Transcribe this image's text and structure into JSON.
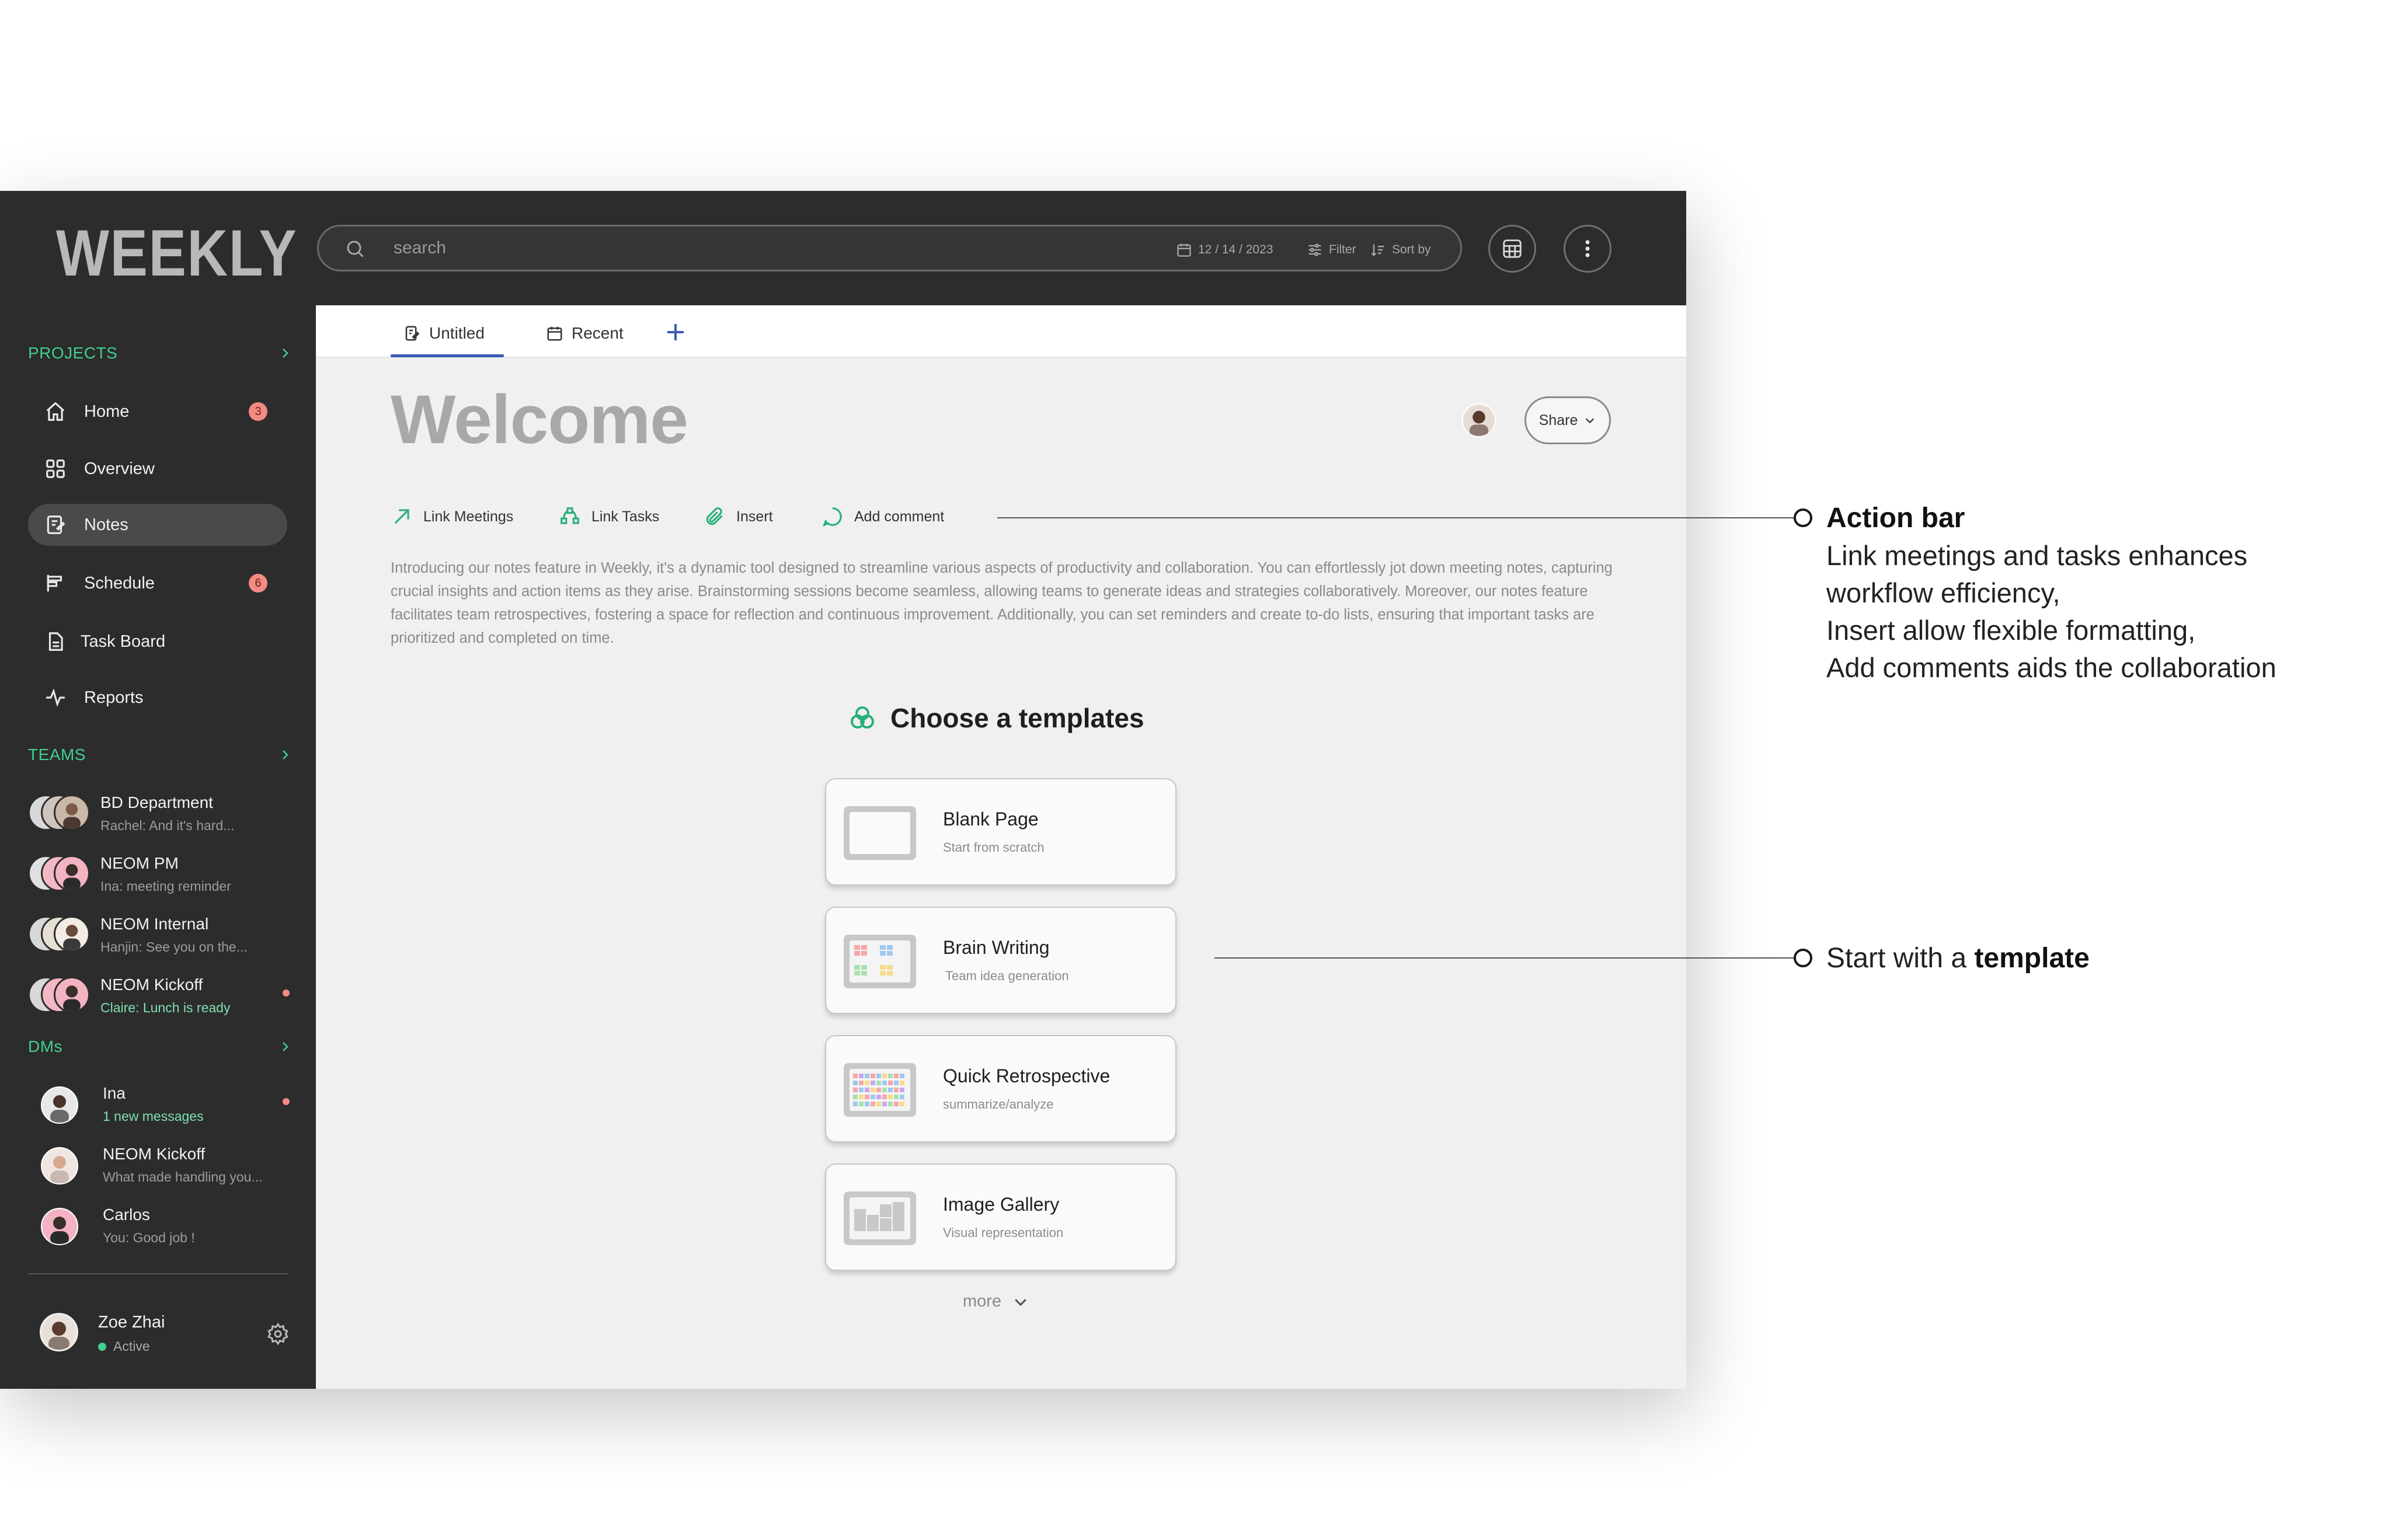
{
  "app": {
    "logo": "WEEKLY",
    "search": {
      "placeholder": "search",
      "date": "12 / 14 / 2023",
      "filter_label": "Filter",
      "sort_label": "Sort by"
    }
  },
  "sidebar": {
    "projects_heading": "PROJECTS",
    "nav": [
      {
        "label": "Home",
        "badge": "3"
      },
      {
        "label": "Overview"
      },
      {
        "label": "Notes"
      },
      {
        "label": "Schedule",
        "badge": "6"
      },
      {
        "label": "Task Board"
      },
      {
        "label": "Reports"
      }
    ],
    "teams_heading": "TEAMS",
    "teams": [
      {
        "name": "BD Department",
        "preview": "Rachel: And it's hard..."
      },
      {
        "name": "NEOM PM",
        "preview": "Ina: meeting reminder"
      },
      {
        "name": "NEOM Internal",
        "preview": "Hanjin: See you on the..."
      },
      {
        "name": "NEOM Kickoff",
        "preview": "Claire: Lunch is ready"
      }
    ],
    "dms_heading": "DMs",
    "dms": [
      {
        "name": "Ina",
        "preview": "1 new messages"
      },
      {
        "name": "NEOM Kickoff",
        "preview": "What made handling you..."
      },
      {
        "name": "Carlos",
        "preview": "You: Good job !"
      }
    ],
    "user": {
      "name": "Zoe Zhai",
      "status": "Active"
    }
  },
  "main": {
    "tabs": [
      {
        "label": "Untitled"
      },
      {
        "label": "Recent"
      }
    ],
    "title": "Welcome",
    "share_label": "Share",
    "actions": [
      {
        "label": "Link Meetings"
      },
      {
        "label": "Link Tasks"
      },
      {
        "label": "Insert"
      },
      {
        "label": "Add comment"
      }
    ],
    "intro": "Introducing our notes feature in Weekly, it's a dynamic tool designed to streamline various aspects of productivity and collaboration. You can effortlessly jot down meeting notes, capturing crucial insights and action items as they arise. Brainstorming sessions become seamless, allowing teams to generate ideas and strategies collaboratively. Moreover, our notes feature facilitates team retrospectives, fostering a space for reflection and continuous improvement. Additionally, you can set reminders and create to-do lists, ensuring that important tasks are prioritized and completed on time.",
    "templates_heading": "Choose a templates",
    "templates": [
      {
        "title": "Blank Page",
        "subtitle": "Start from scratch"
      },
      {
        "title": "Brain Writing",
        "subtitle": "Team idea generation"
      },
      {
        "title": "Quick Retrospective",
        "subtitle": "summarize/analyze"
      },
      {
        "title": "Image Gallery",
        "subtitle": "Visual representation"
      }
    ],
    "more_label": "more"
  },
  "annotations": {
    "action_bar": {
      "title": "Action bar",
      "lines": [
        "Link meetings and tasks enhances",
        "workflow efficiency,",
        "Insert allow flexible formatting,",
        "Add comments aids the collaboration"
      ]
    },
    "template": {
      "prefix": "Start with a ",
      "emphasis": "template"
    }
  },
  "colors": {
    "accent_green": "#3fcf8e",
    "badge_red": "#f28b82",
    "tab_blue": "#3b5bb5",
    "topbar": "#2c2c2c"
  }
}
